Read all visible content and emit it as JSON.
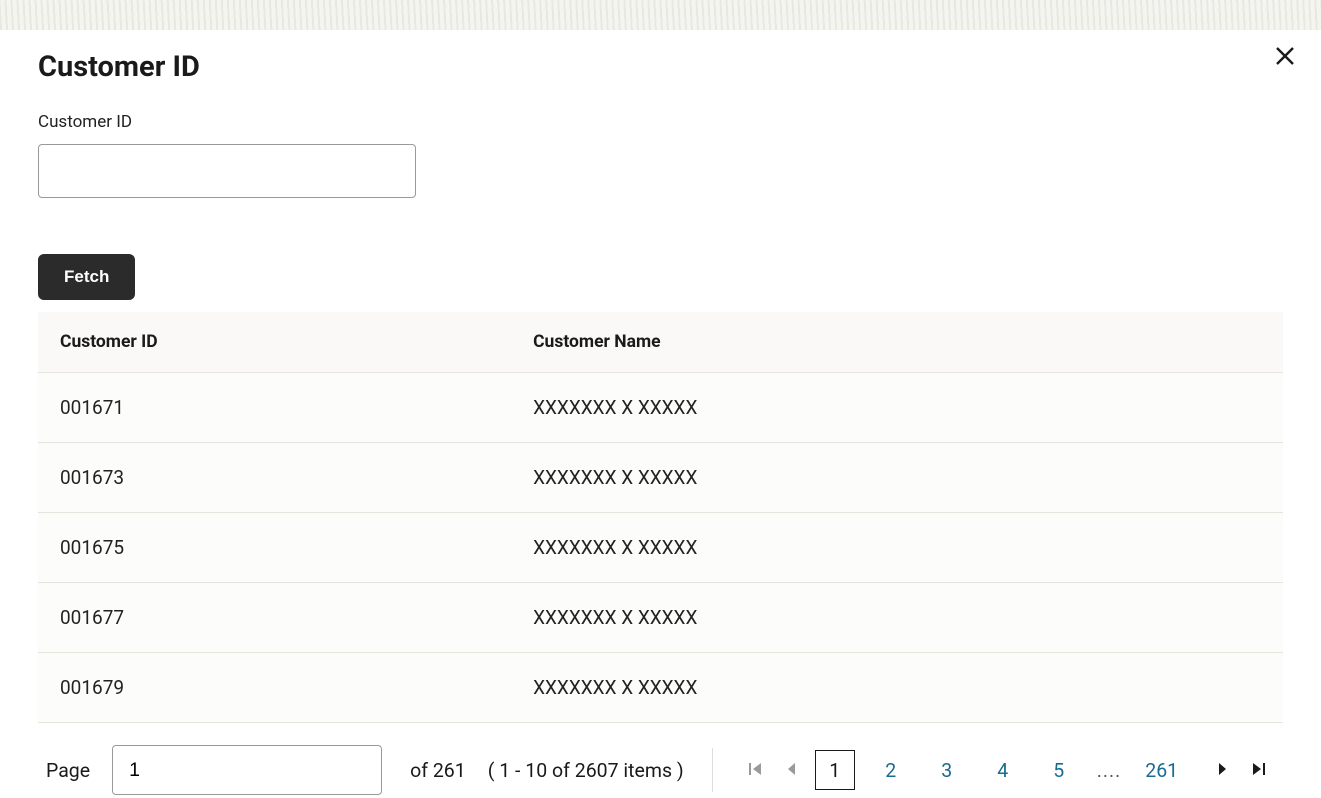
{
  "dialog": {
    "title": "Customer ID",
    "field_label": "Customer ID",
    "field_value": "",
    "fetch_label": "Fetch"
  },
  "table": {
    "headers": {
      "col1": "Customer ID",
      "col2": "Customer Name"
    },
    "rows": [
      {
        "id": "001671",
        "name": "XXXXXXX X XXXXX"
      },
      {
        "id": "001673",
        "name": "XXXXXXX X XXXXX"
      },
      {
        "id": "001675",
        "name": "XXXXXXX X XXXXX"
      },
      {
        "id": "001677",
        "name": "XXXXXXX X XXXXX"
      },
      {
        "id": "001679",
        "name": "XXXXXXX X XXXXX"
      }
    ]
  },
  "pagination": {
    "page_label": "Page",
    "page_value": "1",
    "of_text": "of 261",
    "range_text": "( 1 - 10 of 2607 items )",
    "current": "1",
    "links": [
      "2",
      "3",
      "4",
      "5"
    ],
    "dots": "....",
    "last": "261"
  }
}
